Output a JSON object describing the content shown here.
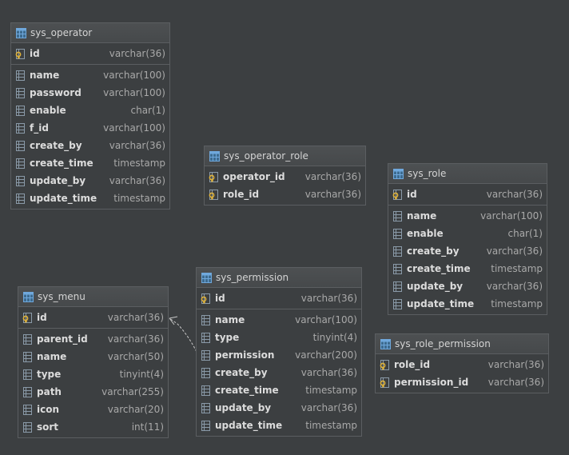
{
  "tables": {
    "sys_operator": {
      "name": "sys_operator",
      "pk": [
        {
          "name": "id",
          "type": "varchar(36)"
        }
      ],
      "columns": [
        {
          "name": "name",
          "type": "varchar(100)"
        },
        {
          "name": "password",
          "type": "varchar(100)"
        },
        {
          "name": "enable",
          "type": "char(1)"
        },
        {
          "name": "f_id",
          "type": "varchar(100)"
        },
        {
          "name": "create_by",
          "type": "varchar(36)"
        },
        {
          "name": "create_time",
          "type": "timestamp"
        },
        {
          "name": "update_by",
          "type": "varchar(36)"
        },
        {
          "name": "update_time",
          "type": "timestamp"
        }
      ]
    },
    "sys_operator_role": {
      "name": "sys_operator_role",
      "pk": [
        {
          "name": "operator_id",
          "type": "varchar(36)"
        },
        {
          "name": "role_id",
          "type": "varchar(36)"
        }
      ],
      "columns": []
    },
    "sys_role": {
      "name": "sys_role",
      "pk": [
        {
          "name": "id",
          "type": "varchar(36)"
        }
      ],
      "columns": [
        {
          "name": "name",
          "type": "varchar(100)"
        },
        {
          "name": "enable",
          "type": "char(1)"
        },
        {
          "name": "create_by",
          "type": "varchar(36)"
        },
        {
          "name": "create_time",
          "type": "timestamp"
        },
        {
          "name": "update_by",
          "type": "varchar(36)"
        },
        {
          "name": "update_time",
          "type": "timestamp"
        }
      ]
    },
    "sys_menu": {
      "name": "sys_menu",
      "pk": [
        {
          "name": "id",
          "type": "varchar(36)"
        }
      ],
      "columns": [
        {
          "name": "parent_id",
          "type": "varchar(36)"
        },
        {
          "name": "name",
          "type": "varchar(50)"
        },
        {
          "name": "type",
          "type": "tinyint(4)"
        },
        {
          "name": "path",
          "type": "varchar(255)"
        },
        {
          "name": "icon",
          "type": "varchar(20)"
        },
        {
          "name": "sort",
          "type": "int(11)"
        }
      ]
    },
    "sys_permission": {
      "name": "sys_permission",
      "pk": [
        {
          "name": "id",
          "type": "varchar(36)"
        }
      ],
      "columns": [
        {
          "name": "name",
          "type": "varchar(100)"
        },
        {
          "name": "type",
          "type": "tinyint(4)"
        },
        {
          "name": "permission",
          "type": "varchar(200)"
        },
        {
          "name": "create_by",
          "type": "varchar(36)"
        },
        {
          "name": "create_time",
          "type": "timestamp"
        },
        {
          "name": "update_by",
          "type": "varchar(36)"
        },
        {
          "name": "update_time",
          "type": "timestamp"
        }
      ]
    },
    "sys_role_permission": {
      "name": "sys_role_permission",
      "pk": [
        {
          "name": "role_id",
          "type": "varchar(36)"
        },
        {
          "name": "permission_id",
          "type": "varchar(36)"
        }
      ],
      "columns": []
    }
  },
  "colors": {
    "background": "#3c3f41",
    "header": "#4d5052",
    "border": "#5b5e61",
    "table_icon": "#6fa8dc",
    "key_icon": "#e0b33a",
    "relation_line": "#c8c8c8"
  },
  "icons": {
    "table": "table-icon",
    "primary_key": "primary-key-icon",
    "column": "column-icon"
  }
}
